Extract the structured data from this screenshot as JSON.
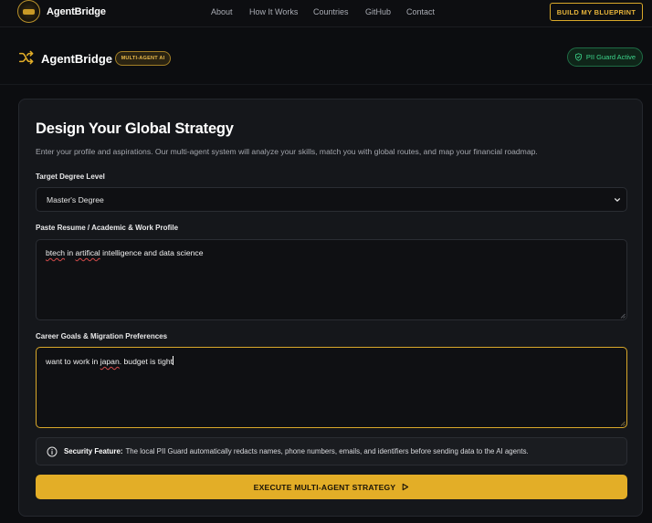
{
  "topnav": {
    "brand": "AgentBridge",
    "links": [
      "About",
      "How It Works",
      "Countries",
      "GitHub",
      "Contact"
    ],
    "cta_label": "BUILD MY BLUEPRINT"
  },
  "header": {
    "brand": "AgentBridge",
    "badge": "MULTI-AGENT AI",
    "status_badge": "PII Guard Active"
  },
  "form": {
    "title": "Design Your Global Strategy",
    "subtitle": "Enter your profile and aspirations. Our multi-agent system will analyze your skills, match you with global routes, and map your financial roadmap.",
    "degree_label": "Target Degree Level",
    "degree_value": "Master's Degree",
    "profile_label": "Paste Resume / Academic & Work Profile",
    "profile_value_parts": [
      "btech",
      " in ",
      "artifical",
      " intelligence and data science"
    ],
    "goals_label": "Career Goals & Migration Preferences",
    "goals_value_parts": [
      "want to work in ",
      "japan",
      ". budget is tight"
    ],
    "security_title": "Security Feature:",
    "security_text": "The local PII Guard automatically redacts names, phone numbers, emails, and identifiers before sending data to the AI agents.",
    "submit_label": "EXECUTE MULTI-AGENT STRATEGY"
  },
  "colors": {
    "accent": "#e3ae27",
    "success": "#3dd68c",
    "background": "#0c0d10",
    "card": "#15171b"
  },
  "icons": {
    "logo": "agentbridge-emblem-icon",
    "brand": "shuffle-icon",
    "status": "shield-check-icon",
    "security": "info-icon",
    "submit": "play-icon",
    "select": "chevron-down-icon"
  }
}
